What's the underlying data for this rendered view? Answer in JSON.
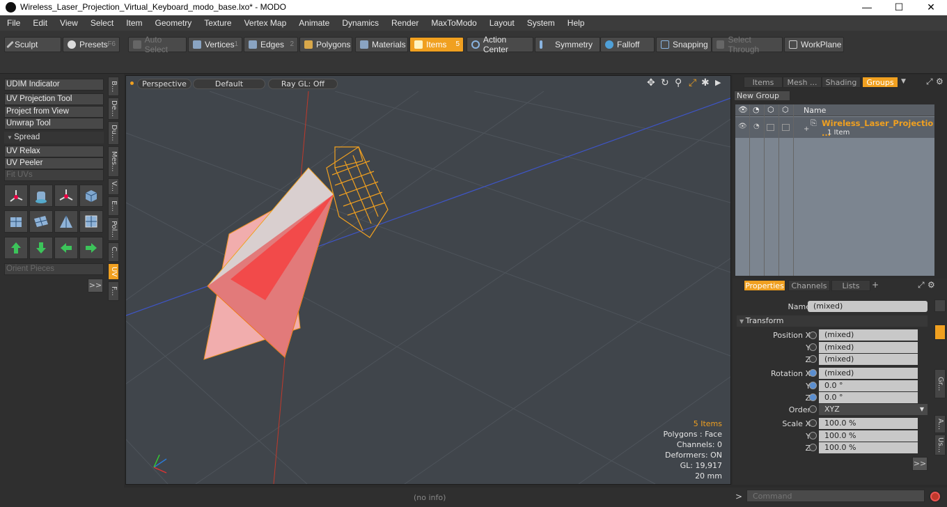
{
  "window": {
    "title": "Wireless_Laser_Projection_Virtual_Keyboard_modo_base.lxo* - MODO",
    "min": "—",
    "max": "☐",
    "close": "✕"
  },
  "menu": [
    "File",
    "Edit",
    "View",
    "Select",
    "Item",
    "Geometry",
    "Texture",
    "Vertex Map",
    "Animate",
    "Dynamics",
    "Render",
    "MaxToModo",
    "Layout",
    "System",
    "Help"
  ],
  "toolbar": {
    "sculpt": "Sculpt",
    "presets": "Presets",
    "presets_key": "F6",
    "auto_select": "Auto Select",
    "vertices": "Vertices",
    "vertices_key": "1",
    "edges": "Edges",
    "edges_key": "2",
    "polygons": "Polygons",
    "materials": "Materials",
    "items": "Items",
    "items_key": "5",
    "action_center": "Action Center",
    "symmetry": "Symmetry",
    "falloff": "Falloff",
    "snapping": "Snapping",
    "select_through": "Select Through",
    "workplane": "WorkPlane"
  },
  "left": {
    "udim": "UDIM Indicator",
    "uv_projection": "UV Projection Tool",
    "project_view": "Project from View",
    "unwrap": "Unwrap Tool",
    "spread": "Spread",
    "uv_relax": "UV Relax",
    "uv_peeler": "UV Peeler",
    "fit_uvs": "Fit UVs",
    "orient": "Orient Pieces",
    "more": ">>",
    "vtabs": [
      "B...",
      "De...",
      "Du...",
      "Mes...",
      "V...",
      "E...",
      "Pol...",
      "C...",
      "UV",
      "F..."
    ]
  },
  "viewport": {
    "view": "Perspective",
    "shading": "Default",
    "raygl": "Ray GL: Off",
    "stats": {
      "items": "5 Items",
      "polygons": "Polygons : Face",
      "channels": "Channels: 0",
      "deformers": "Deformers: ON",
      "gl": "GL: 19,917",
      "unit": "20 mm"
    }
  },
  "groups_panel": {
    "tabs": [
      "Items",
      "Mesh ...",
      "Shading",
      "Groups"
    ],
    "new_group": "New Group",
    "col_name": "Name",
    "item_name": "Wireless_Laser_Projectio ...",
    "item_count": "1 Item"
  },
  "properties": {
    "tabs": [
      "Properties",
      "Channels",
      "Lists"
    ],
    "plus": "+",
    "name_label": "Name",
    "name_value": "(mixed)",
    "transform": "Transform",
    "pos_x_label": "Position X",
    "pos_x": "(mixed)",
    "pos_y": "(mixed)",
    "pos_z": "(mixed)",
    "rot_x_label": "Rotation X",
    "rot_x": "(mixed)",
    "rot_y": "0.0 °",
    "rot_z": "0.0 °",
    "order_label": "Order",
    "order": "XYZ",
    "scale_x_label": "Scale X",
    "scale_x": "100.0 %",
    "scale_y": "100.0 %",
    "scale_z": "100.0 %",
    "y": "Y",
    "z": "Z",
    "more": ">>",
    "side_tabs": [
      "Gr...",
      "A...",
      "Us..."
    ]
  },
  "status": {
    "info": "(no info)",
    "command_placeholder": "Command",
    "arrow": ">"
  },
  "colors": {
    "accent": "#f0a020",
    "viewport_bg": "#40454b",
    "panel": "#2f2f2f"
  }
}
